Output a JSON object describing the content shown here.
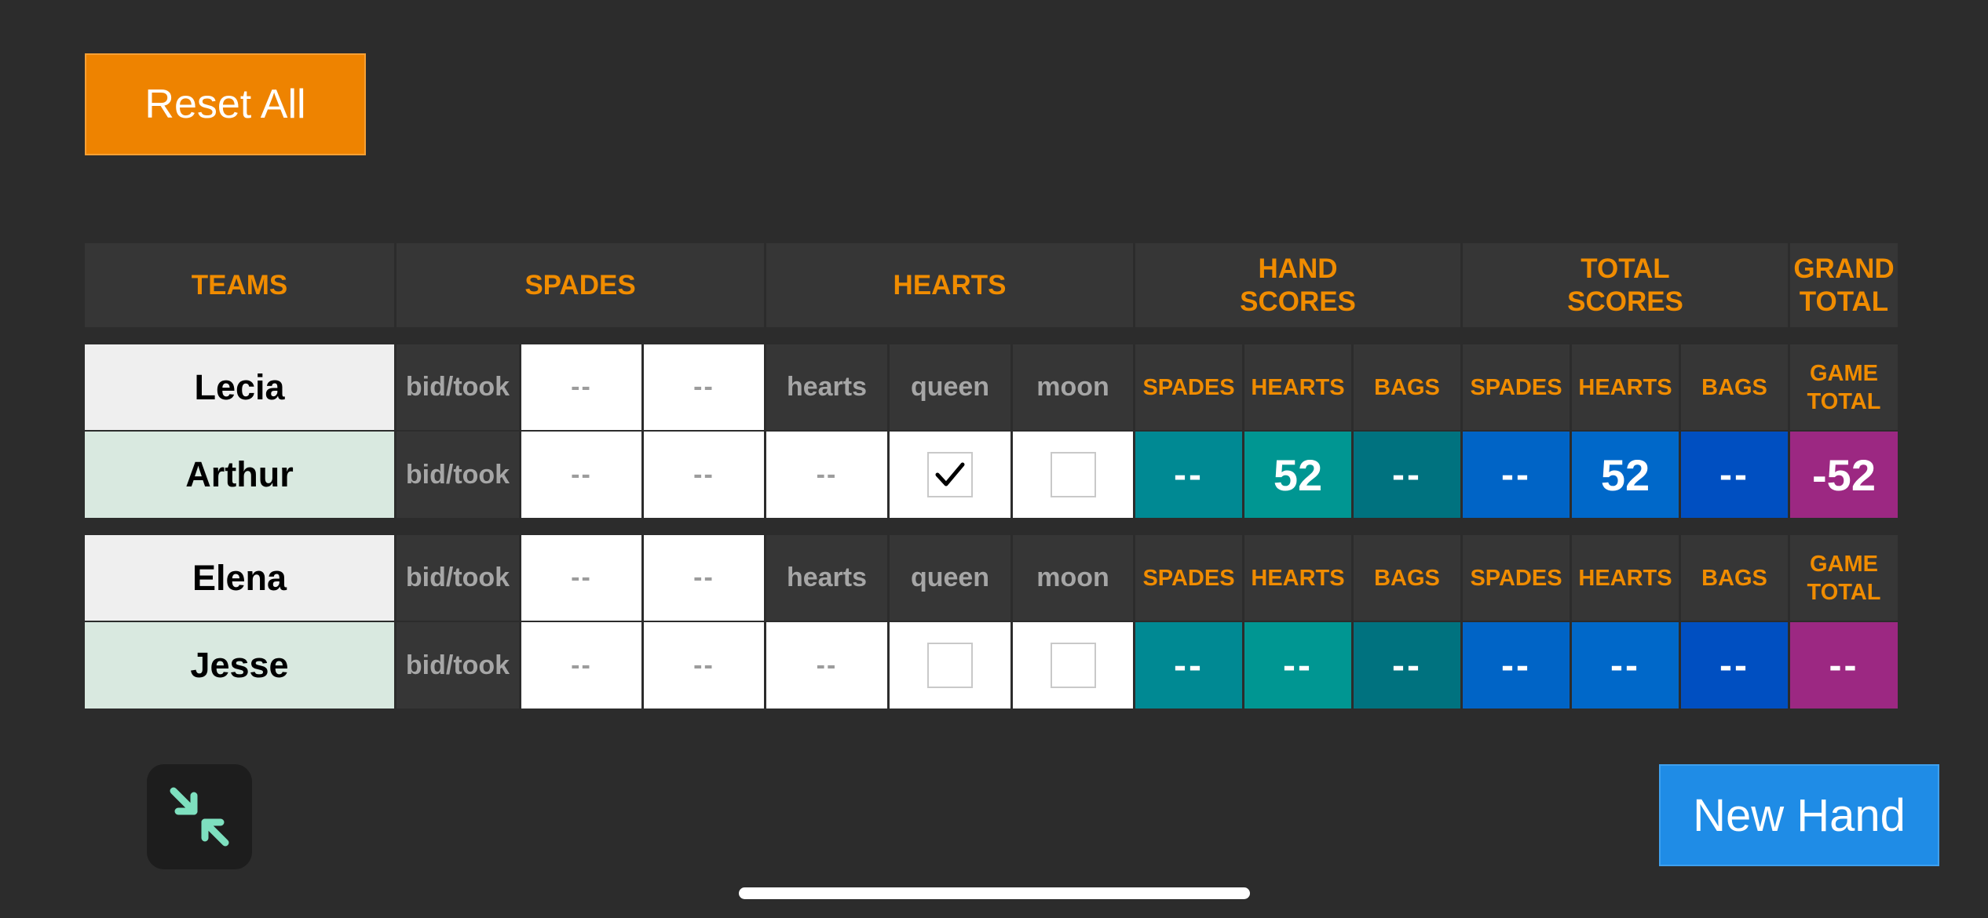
{
  "buttons": {
    "reset_all": "Reset All",
    "new_hand": "New Hand"
  },
  "icons": {
    "collapse": "arrows-collapse-icon",
    "collapse_color": "#7ee0bf",
    "checkmark": "checkmark-icon"
  },
  "colors": {
    "accent_orange": "#ee8300",
    "new_hand_blue": "#1f8ce6",
    "header_text": "#f08c00",
    "game_total": "#9c2882"
  },
  "headers": {
    "teams": "TEAMS",
    "spades": "SPADES",
    "hearts": "HEARTS",
    "hand_scores": [
      "HAND",
      "SCORES"
    ],
    "total_scores": [
      "TOTAL",
      "SCORES"
    ],
    "grand_total": [
      "GRAND",
      "TOTAL"
    ]
  },
  "teams": [
    {
      "players": [
        "Lecia",
        "Arthur"
      ],
      "labels": {
        "bid_took": "bid/took",
        "hearts": "hearts",
        "queen": "queen",
        "moon": "moon",
        "hand_spades": "SPADES",
        "hand_hearts": "HEARTS",
        "hand_bags": "BAGS",
        "total_spades": "SPADES",
        "total_hearts": "HEARTS",
        "total_bags": "BAGS",
        "game_total": [
          "GAME",
          "TOTAL"
        ]
      },
      "rows": [
        {
          "bid_took": "bid/took",
          "bid": "--",
          "took": "--"
        },
        {
          "bid_took": "bid/took",
          "bid": "--",
          "took": "--"
        }
      ],
      "hearts_value": "--",
      "queen_checked": true,
      "moon_checked": false,
      "hand_scores": {
        "spades": "--",
        "hearts": "52",
        "bags": "--"
      },
      "total_scores": {
        "spades": "--",
        "hearts": "52",
        "bags": "--"
      },
      "game_total": "-52"
    },
    {
      "players": [
        "Elena",
        "Jesse"
      ],
      "labels": {
        "bid_took": "bid/took",
        "hearts": "hearts",
        "queen": "queen",
        "moon": "moon",
        "hand_spades": "SPADES",
        "hand_hearts": "HEARTS",
        "hand_bags": "BAGS",
        "total_spades": "SPADES",
        "total_hearts": "HEARTS",
        "total_bags": "BAGS",
        "game_total": [
          "GAME",
          "TOTAL"
        ]
      },
      "rows": [
        {
          "bid_took": "bid/took",
          "bid": "--",
          "took": "--"
        },
        {
          "bid_took": "bid/took",
          "bid": "--",
          "took": "--"
        }
      ],
      "hearts_value": "--",
      "queen_checked": false,
      "moon_checked": false,
      "hand_scores": {
        "spades": "--",
        "hearts": "--",
        "bags": "--"
      },
      "total_scores": {
        "spades": "--",
        "hearts": "--",
        "bags": "--"
      },
      "game_total": "--"
    }
  ]
}
